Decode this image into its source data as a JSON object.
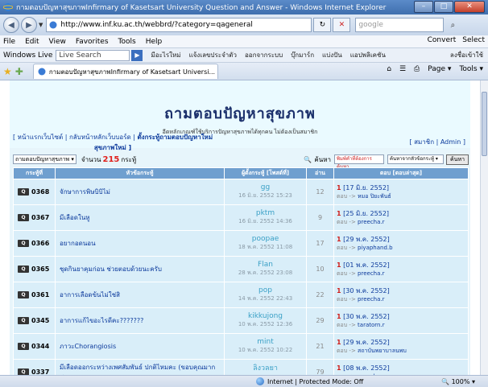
{
  "window": {
    "title": "กามตอบปัญหาสุขภาพInfirmary of Kasetsart University Question and Answer - Windows Internet Explorer",
    "controls": [
      "–",
      "□",
      "✕"
    ]
  },
  "address": {
    "url": "http://www.inf.ku.ac.th/webbrd/?category=qageneral",
    "search_placeholder": "google"
  },
  "menu": {
    "items": [
      "File",
      "Edit",
      "View",
      "Favorites",
      "Tools",
      "Help"
    ],
    "convert": "Convert",
    "select": "Select"
  },
  "links": {
    "windows_live": "Windows Live",
    "live_search": "Live Search",
    "thai_links": [
      "มีอะไรใหม่",
      "แจ้งเลขประจำตัว",
      "ออกจากระบบ",
      "บุ๊กมาร์ก",
      "แบ่งปัน",
      "แอปพลิเคชัน"
    ],
    "right_link": "ลงชื่อเข้าใช้"
  },
  "tabs": {
    "active": "กามตอบปัญหาสุขภาพInfirmary of Kasetsart Universi...",
    "page_label": "Page",
    "tools_label": "Tools"
  },
  "page": {
    "title": "ถามตอบปัญหาสุขภาพ",
    "subtitle": "อีดหลักเกณฑ์ใช้บริการปัญหาสุขภาพได้ทุกคน ไม่ต้องเป็นสมาชิก",
    "toplink_home": "[ หน้าแรกเว็บไซต์ |",
    "toplink_board": "กลับหน้าหลักเว็บบอร์ด |",
    "toplink_new": "ตั้งกระทู้ถามตอบปัญหาใหม่",
    "toplink_tail": "สุขภาพใหม่ ]",
    "member_link": "[ สมาชิก | Admin ]",
    "filter_select": "ถามตอบปัญหาสุขภาพ",
    "count_label": "จำนวน",
    "count_value": "215",
    "count_unit": "กระทู้",
    "search_label": "ค้นหา",
    "search_placeholder": "พิมพ์คำที่ต้องการค้นหา",
    "search_scope": "ค้นหาจากหัวข้อกระทู้",
    "search_button": "ค้นหา"
  },
  "table": {
    "headers": [
      "กระทู้ที่",
      "หัวข้อกระทู้",
      "ผู้ตั้งกระทู้ [โพสต์ที่]",
      "อ่าน",
      "ตอบ [ตอบล่าสุด]"
    ],
    "rows": [
      {
        "id": "0368",
        "topic": "จักษาการพิษบิบิไม่",
        "author": "gg",
        "date": "16 มิ.ย. 2552 15:23",
        "reads": "12",
        "replies": "1",
        "last_date": "[17 มิ.ย. 2552]",
        "last_by": "หมอ ปิยะพันธ์"
      },
      {
        "id": "0367",
        "topic": "มีเลือดในหู",
        "author": "pktm",
        "date": "16 มิ.ย. 2552 14:36",
        "reads": "9",
        "replies": "1",
        "last_date": "[25 มิ.ย. 2552]",
        "last_by": "preecha.r"
      },
      {
        "id": "0366",
        "topic": "อยากอดนอน",
        "author": "poopae",
        "date": "18 พ.ค. 2552 11:08",
        "reads": "17",
        "replies": "1",
        "last_date": "[29 พ.ค. 2552]",
        "last_by": "piyaphand.b"
      },
      {
        "id": "0365",
        "topic": "ชุดกินยาคุมก่อน ช่วยตอบด้วยนะครับ",
        "author": "Flan",
        "date": "28 พ.ค. 2552 23:08",
        "reads": "10",
        "replies": "1",
        "last_date": "[01 พ.ค. 2552]",
        "last_by": "preecha.r"
      },
      {
        "id": "0361",
        "topic": "อาการเลือดข้นไม่ใช่สิ",
        "author": "pop",
        "date": "14 พ.ค. 2552 22:43",
        "reads": "22",
        "replies": "1",
        "last_date": "[30 พ.ค. 2552]",
        "last_by": "preecha.r"
      },
      {
        "id": "0345",
        "topic": "อาการแก้ไขอะไรดีคะ???????",
        "author": "kikkujong",
        "date": "10 พ.ค. 2552 12:36",
        "reads": "29",
        "replies": "1",
        "last_date": "[30 พ.ค. 2552]",
        "last_by": "taratorn.r"
      },
      {
        "id": "0344",
        "topic": "ภาวะChorangiosis",
        "author": "mint",
        "date": "10 พ.ค. 2552 10:22",
        "reads": "21",
        "replies": "1",
        "last_date": "[29 พ.ค. 2552]",
        "last_by": "สถาบันพยาบาลนพบ"
      },
      {
        "id": "0337",
        "topic": "มีเลือดออกระหว่างเพศสัมพันธ์ ปกติไหมคะ (ขอบคุณมากค่ะ)",
        "author": "ลิงวลยา",
        "date": "06 พ.ค. 2552 10:26",
        "reads": "79",
        "replies": "1",
        "last_date": "[08 พ.ค. 2552]",
        "last_by": "preecha.r"
      }
    ]
  },
  "status": {
    "zone": "Internet | Protected Mode: Off",
    "zoom": "100%"
  }
}
